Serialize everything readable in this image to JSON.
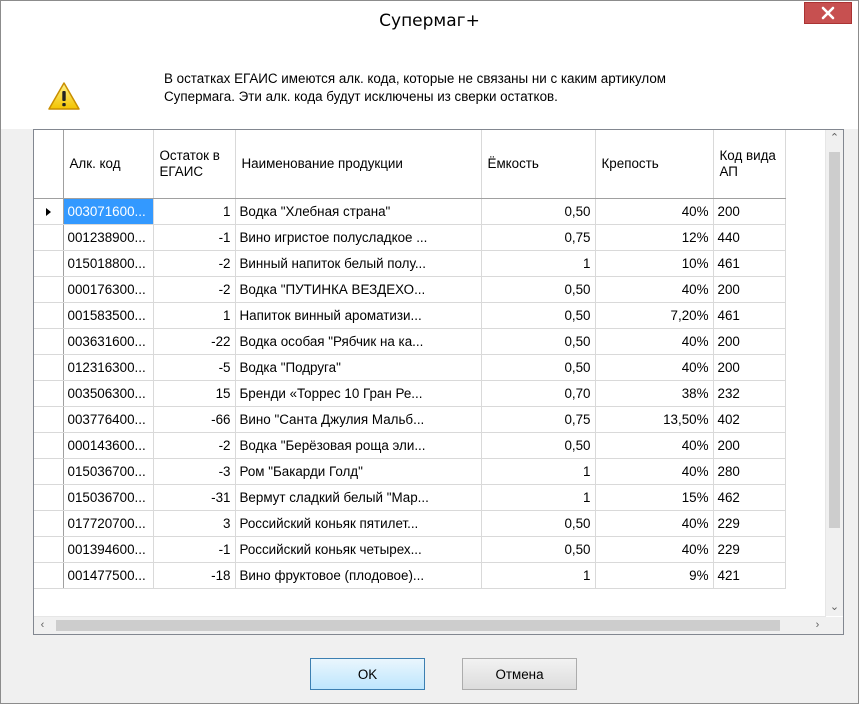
{
  "window": {
    "title": "Супермаг+"
  },
  "message": {
    "line1": "В остатках ЕГАИС имеются алк. кода, которые не связаны ни с каким артикулом",
    "line2": "Супермага. Эти алк. кода будут исключены из сверки остатков."
  },
  "table": {
    "columns": [
      "Алк. код",
      "Остаток в ЕГАИС",
      "Наименование продукции",
      "Ёмкость",
      "Крепость",
      "Код вида АП"
    ],
    "rows": [
      [
        "003071600...",
        "1",
        "Водка \"Хлебная страна\"",
        "0,50",
        "40%",
        "200"
      ],
      [
        "001238900...",
        "-1",
        "Вино игристое полусладкое ...",
        "0,75",
        "12%",
        "440"
      ],
      [
        "015018800...",
        "-2",
        "Винный напиток белый полу...",
        "1",
        "10%",
        "461"
      ],
      [
        "000176300...",
        "-2",
        "Водка \"ПУТИНКА ВЕЗДЕХО...",
        "0,50",
        "40%",
        "200"
      ],
      [
        "001583500...",
        "1",
        "Напиток винный ароматизи...",
        "0,50",
        "7,20%",
        "461"
      ],
      [
        "003631600...",
        "-22",
        "Водка особая \"Рябчик на ка...",
        "0,50",
        "40%",
        "200"
      ],
      [
        "012316300...",
        "-5",
        "Водка \"Подруга\"",
        "0,50",
        "40%",
        "200"
      ],
      [
        "003506300...",
        "15",
        "Бренди «Торрес 10 Гран Ре...",
        "0,70",
        "38%",
        "232"
      ],
      [
        "003776400...",
        "-66",
        "Вино \"Санта Джулия Мальб...",
        "0,75",
        "13,50%",
        "402"
      ],
      [
        "000143600...",
        "-2",
        "Водка \"Берёзовая роща эли...",
        "0,50",
        "40%",
        "200"
      ],
      [
        "015036700...",
        "-3",
        "Ром \"Бакарди Голд\"",
        "1",
        "40%",
        "280"
      ],
      [
        "015036700...",
        "-31",
        "Вермут сладкий белый \"Мар...",
        "1",
        "15%",
        "462"
      ],
      [
        "017720700...",
        "3",
        "Российский коньяк пятилет...",
        "0,50",
        "40%",
        "229"
      ],
      [
        "001394600...",
        "-1",
        "Российский коньяк четырех...",
        "0,50",
        "40%",
        "229"
      ],
      [
        "001477500...",
        "-18",
        "Вино фруктовое (плодовое)...",
        "1",
        "9%",
        "421"
      ]
    ]
  },
  "buttons": {
    "ok": "OK",
    "cancel": "Отмена"
  },
  "icons": {
    "close": "close-icon",
    "warning": "warning-icon"
  },
  "colors": {
    "selection": "#3399ff",
    "close_button": "#c75050"
  }
}
